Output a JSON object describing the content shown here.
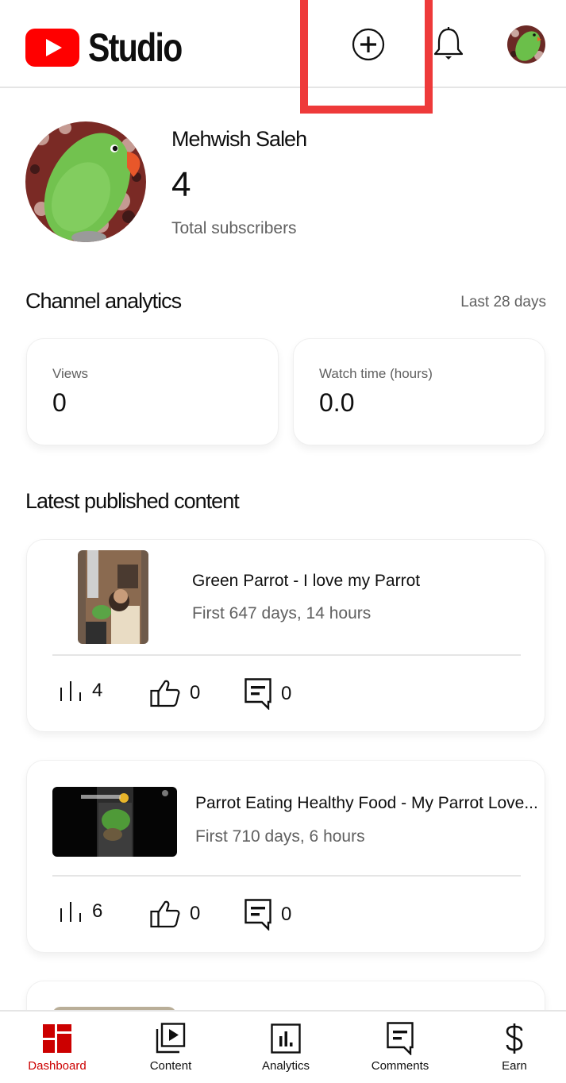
{
  "header": {
    "app_title": "Studio",
    "create_icon": "plus-circle-icon",
    "notifications_icon": "bell-icon",
    "account_icon": "avatar"
  },
  "colors": {
    "brand_red": "#ff0000",
    "active_nav": "#cc0000",
    "annotation": "#ee3a3a",
    "secondary_text": "#606060"
  },
  "channel": {
    "name": "Mehwish Saleh",
    "subscriber_count": "4",
    "subscriber_label": "Total subscribers"
  },
  "analytics": {
    "title": "Channel analytics",
    "period": "Last 28 days",
    "metrics": [
      {
        "label": "Views",
        "value": "0"
      },
      {
        "label": "Watch time (hours)",
        "value": "0.0"
      }
    ]
  },
  "latest": {
    "title": "Latest published content",
    "videos": [
      {
        "title": "Green Parrot - I love my Parrot",
        "subtitle": "First 647 days, 14 hours",
        "views": "4",
        "likes": "0",
        "comments": "0"
      },
      {
        "title": "Parrot Eating Healthy Food - My Parrot Love...",
        "subtitle": "First 710 days, 6 hours",
        "views": "6",
        "likes": "0",
        "comments": "0"
      }
    ]
  },
  "nav": {
    "items": [
      {
        "label": "Dashboard",
        "icon": "dashboard-icon",
        "active": true
      },
      {
        "label": "Content",
        "icon": "content-icon",
        "active": false
      },
      {
        "label": "Analytics",
        "icon": "analytics-icon",
        "active": false
      },
      {
        "label": "Comments",
        "icon": "comments-icon",
        "active": false
      },
      {
        "label": "Earn",
        "icon": "dollar-icon",
        "active": false
      }
    ]
  }
}
